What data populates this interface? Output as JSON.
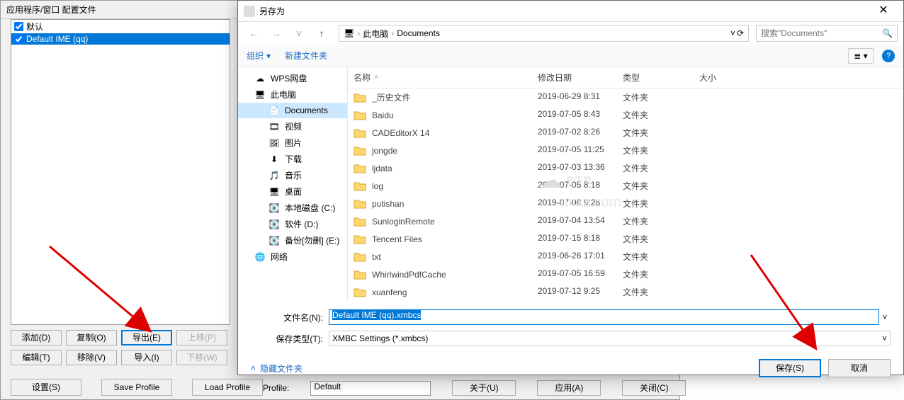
{
  "bg": {
    "title": "应用程序/窗口 配置文件",
    "items": [
      {
        "label": "默认",
        "checked": true,
        "selected": false
      },
      {
        "label": "Default IME (qq)",
        "checked": true,
        "selected": true
      }
    ],
    "buttons": {
      "add": "添加(D)",
      "copy": "复制(O)",
      "export": "导出(E)",
      "moveup": "上移(P)",
      "edit": "编辑(T)",
      "remove": "移除(V)",
      "import": "导入(I)",
      "movedown": "下移(W)",
      "settings": "设置(S)",
      "save_profile": "Save Profile",
      "load_profile": "Load Profile"
    },
    "status": {
      "profile_label": "Profile:",
      "profile_value": "Default",
      "about": "关于(U)",
      "apply": "应用(A)",
      "close": "关闭(C)"
    }
  },
  "dialog": {
    "title": "另存为",
    "breadcrumb": {
      "pc": "此电脑",
      "folder": "Documents"
    },
    "search_placeholder": "搜索\"Documents\"",
    "toolbar": {
      "organize": "组织",
      "newfolder": "新建文件夹"
    },
    "tree": [
      {
        "icon": "cloud",
        "label": "WPS网盘",
        "indent": false
      },
      {
        "icon": "pc",
        "label": "此电脑",
        "indent": false
      },
      {
        "icon": "doc",
        "label": "Documents",
        "indent": true,
        "selected": true
      },
      {
        "icon": "video",
        "label": "视频",
        "indent": true
      },
      {
        "icon": "pic",
        "label": "图片",
        "indent": true
      },
      {
        "icon": "download",
        "label": "下载",
        "indent": true
      },
      {
        "icon": "music",
        "label": "音乐",
        "indent": true
      },
      {
        "icon": "desktop",
        "label": "桌面",
        "indent": true
      },
      {
        "icon": "disk",
        "label": "本地磁盘 (C:)",
        "indent": true
      },
      {
        "icon": "disk",
        "label": "软件 (D:)",
        "indent": true
      },
      {
        "icon": "disk",
        "label": "备份[勿删] (E:)",
        "indent": true
      },
      {
        "icon": "net",
        "label": "网络",
        "indent": false
      }
    ],
    "columns": {
      "name": "名称",
      "date": "修改日期",
      "type": "类型",
      "size": "大小"
    },
    "files": [
      {
        "name": "_历史文件",
        "date": "2019-06-29 8:31",
        "type": "文件夹"
      },
      {
        "name": "Baidu",
        "date": "2019-07-05 8:43",
        "type": "文件夹"
      },
      {
        "name": "CADEditorX 14",
        "date": "2019-07-02 8:26",
        "type": "文件夹"
      },
      {
        "name": "jongde",
        "date": "2019-07-05 11:25",
        "type": "文件夹"
      },
      {
        "name": "ljdata",
        "date": "2019-07-03 13:36",
        "type": "文件夹"
      },
      {
        "name": "log",
        "date": "2019-07-05 8:18",
        "type": "文件夹"
      },
      {
        "name": "putishan",
        "date": "2019-07-08 9:26",
        "type": "文件夹"
      },
      {
        "name": "SunloginRemote",
        "date": "2019-07-04 13:54",
        "type": "文件夹"
      },
      {
        "name": "Tencent Files",
        "date": "2019-07-15 8:18",
        "type": "文件夹"
      },
      {
        "name": "txt",
        "date": "2019-06-26 17:01",
        "type": "文件夹"
      },
      {
        "name": "WhirlwindPdfCache",
        "date": "2019-07-05 16:59",
        "type": "文件夹"
      },
      {
        "name": "xuanfeng",
        "date": "2019-07-12 9:25",
        "type": "文件夹"
      }
    ],
    "footer": {
      "filename_label": "文件名(N):",
      "filename_value": "Default IME (qq).xmbcs",
      "filetype_label": "保存类型(T):",
      "filetype_value": "XMBC Settings (*.xmbcs)",
      "hide_folders": "隐藏文件夹",
      "save": "保存(S)",
      "cancel": "取消"
    }
  },
  "watermark": {
    "main": "安下载",
    "sub": "anxz.com"
  }
}
